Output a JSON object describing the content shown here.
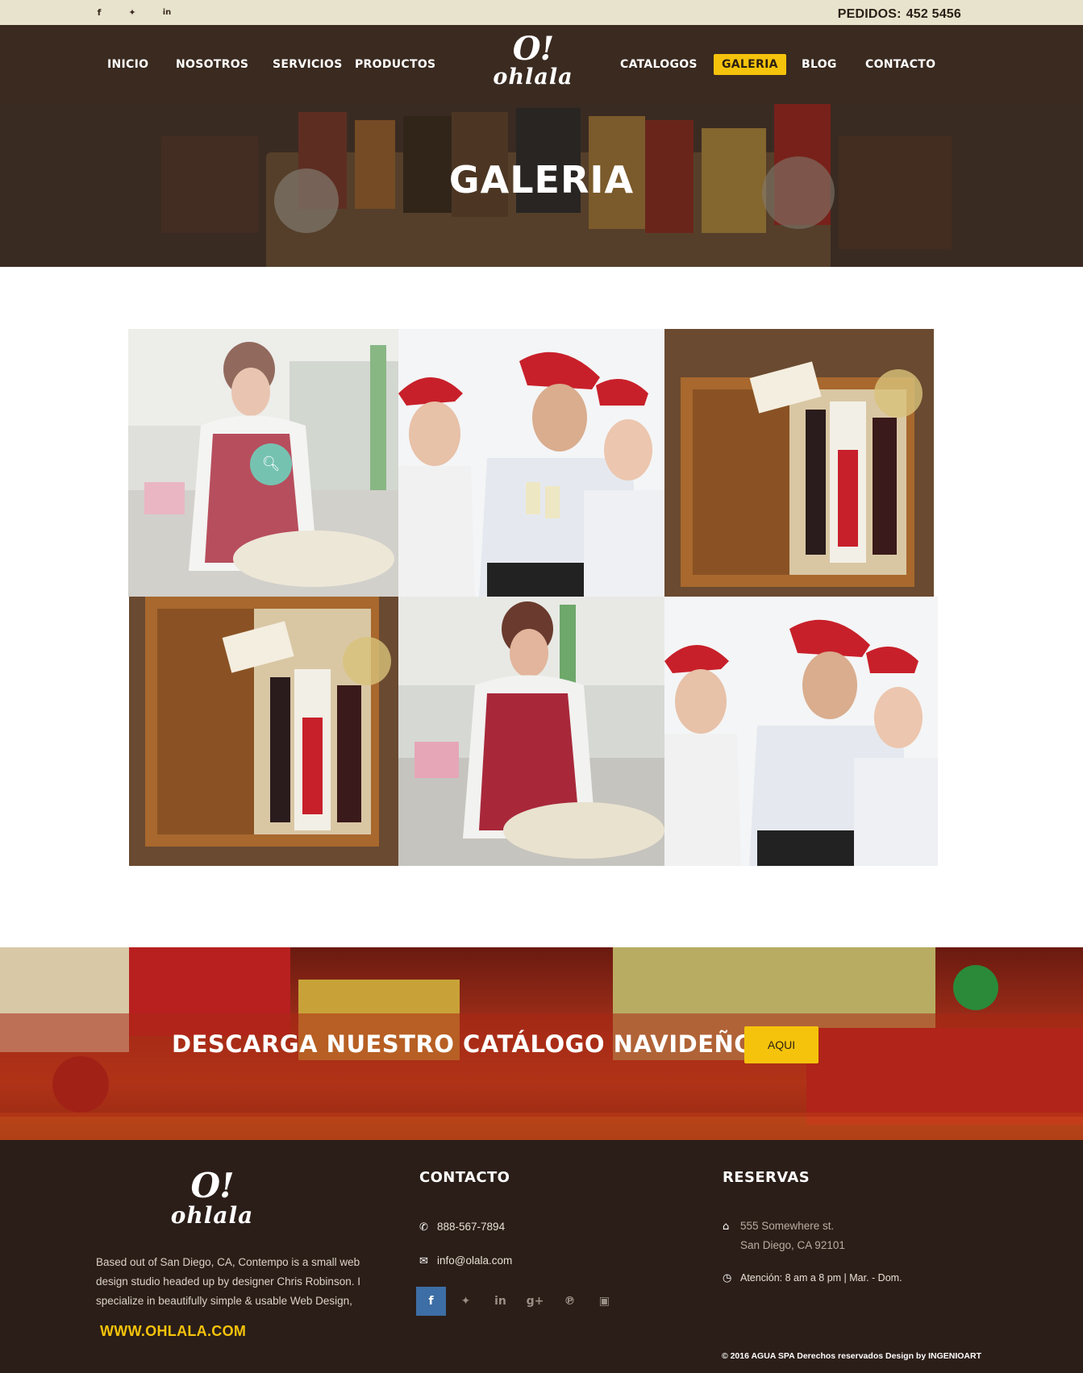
{
  "topbar": {
    "social": [
      {
        "icon": "facebook-icon",
        "glyph": "f"
      },
      {
        "icon": "twitter-icon",
        "glyph": "✦"
      },
      {
        "icon": "linkedin-icon",
        "glyph": "in"
      }
    ],
    "pedidos_label": "PEDIDOS:",
    "pedidos_number": "452 5456"
  },
  "nav": {
    "items_left": [
      "INICIO",
      "NOSOTROS",
      "SERVICIOS",
      "PRODUCTOS"
    ],
    "items_right": [
      "CATALOGOS",
      "GALERIA",
      "BLOG",
      "CONTACTO"
    ],
    "active": "GALERIA",
    "logo_mark": "O!",
    "logo_word": "ohlala"
  },
  "hero": {
    "title": "GALERIA"
  },
  "gallery": {
    "images": [
      {
        "subject": "woman-packing-basket",
        "alt": "Mujer preparando canasta"
      },
      {
        "subject": "christmas-toast",
        "alt": "Brindis navideño"
      },
      {
        "subject": "wine-gift-box",
        "alt": "Caja de vinos"
      },
      {
        "subject": "wine-gift-box",
        "alt": "Caja de vinos"
      },
      {
        "subject": "woman-packing-basket",
        "alt": "Mujer preparando canasta"
      },
      {
        "subject": "christmas-toast",
        "alt": "Brindis navideño"
      }
    ],
    "zoom_icon": "search-icon"
  },
  "banner": {
    "heading": "DESCARGA NUESTRO CATÁLOGO NAVIDEÑO",
    "button": "AQUI"
  },
  "footer": {
    "logo_mark": "O!",
    "logo_word": "ohlala",
    "about": "Based out of San Diego, CA, Contempo is a small web design studio headed up by designer Chris Robinson. I specialize in beautifully simple & usable Web Design,",
    "website": "WWW.OHLALA.COM",
    "contacto_title": "CONTACTO",
    "phone": "888-567-7894",
    "email": "info@olala.com",
    "reservas_title": "RESERVAS",
    "address_line1": "555 Somewhere st.",
    "address_line2": "San Diego, CA 92101",
    "hours": "Atención: 8 am a 8 pm  |  Mar. - Dom.",
    "social": [
      "facebook-icon",
      "twitter-icon",
      "linkedin-icon",
      "google-plus-icon",
      "pinterest-icon",
      "instagram-icon"
    ],
    "social_glyphs": [
      "f",
      "✦",
      "in",
      "g+",
      "℗",
      "▣"
    ],
    "copyright": "© 2016   AGUA SPA   Derechos reservados Design by INGENIOART"
  },
  "colors": {
    "topbar": "#e8e3cc",
    "nav": "#3a2a20",
    "accent": "#f5c30b",
    "footer": "#2b1e18",
    "zoom": "#6fcfba"
  }
}
